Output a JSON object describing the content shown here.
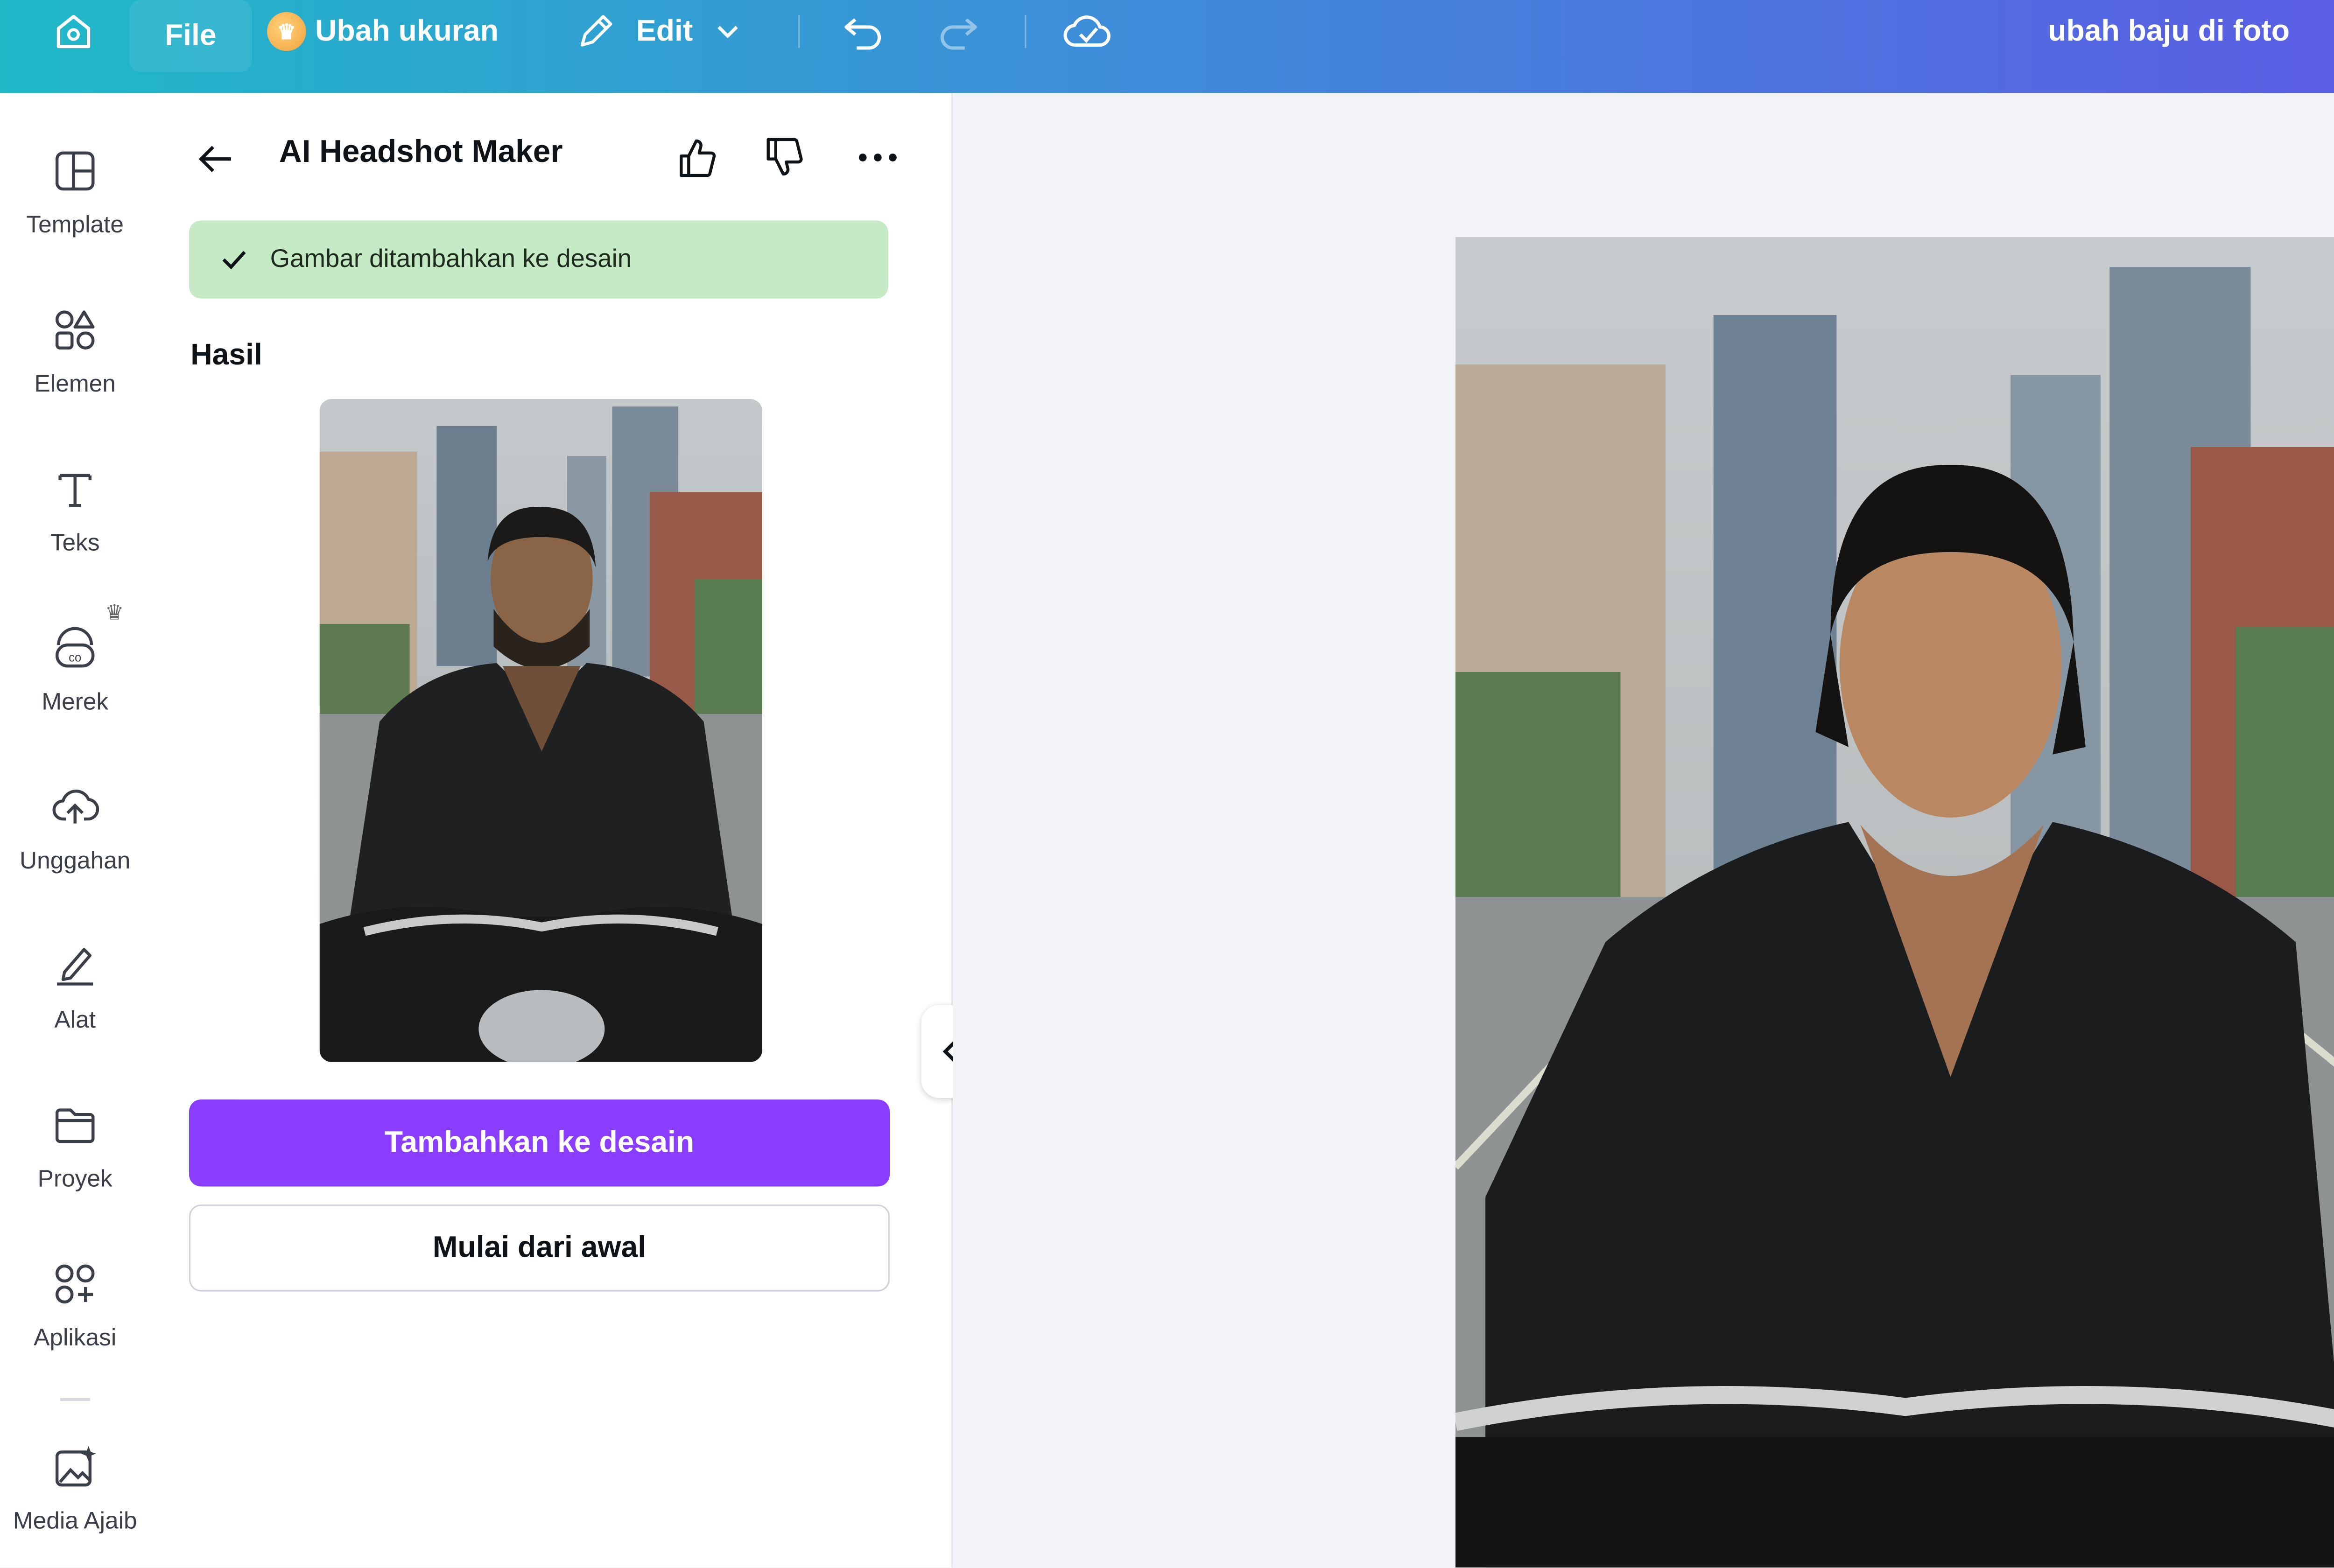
{
  "topbar": {
    "file_label": "File",
    "resize_label": "Ubah ukuran",
    "edit_label": "Edit",
    "document_title": "ubah baju di foto"
  },
  "leftnav": {
    "items": [
      {
        "label": "Template",
        "icon": "template-icon"
      },
      {
        "label": "Elemen",
        "icon": "elements-icon"
      },
      {
        "label": "Teks",
        "icon": "text-icon"
      },
      {
        "label": "Merek",
        "icon": "brand-icon"
      },
      {
        "label": "Unggahan",
        "icon": "upload-icon"
      },
      {
        "label": "Alat",
        "icon": "draw-tool-icon"
      },
      {
        "label": "Proyek",
        "icon": "folder-icon"
      },
      {
        "label": "Aplikasi",
        "icon": "apps-icon"
      },
      {
        "label": "Media Ajaib",
        "icon": "magic-media-icon"
      }
    ]
  },
  "panel": {
    "title": "AI Headshot Maker",
    "toast": "Gambar ditambahkan ke desain",
    "section_label": "Hasil",
    "primary_button": "Tambahkan ke desain",
    "secondary_button": "Mulai dari awal"
  },
  "colors": {
    "accent": "#8b3dff",
    "toast_bg": "#c6eac6",
    "topbar_start": "#1fb9c8",
    "topbar_end": "#5b5de4"
  }
}
